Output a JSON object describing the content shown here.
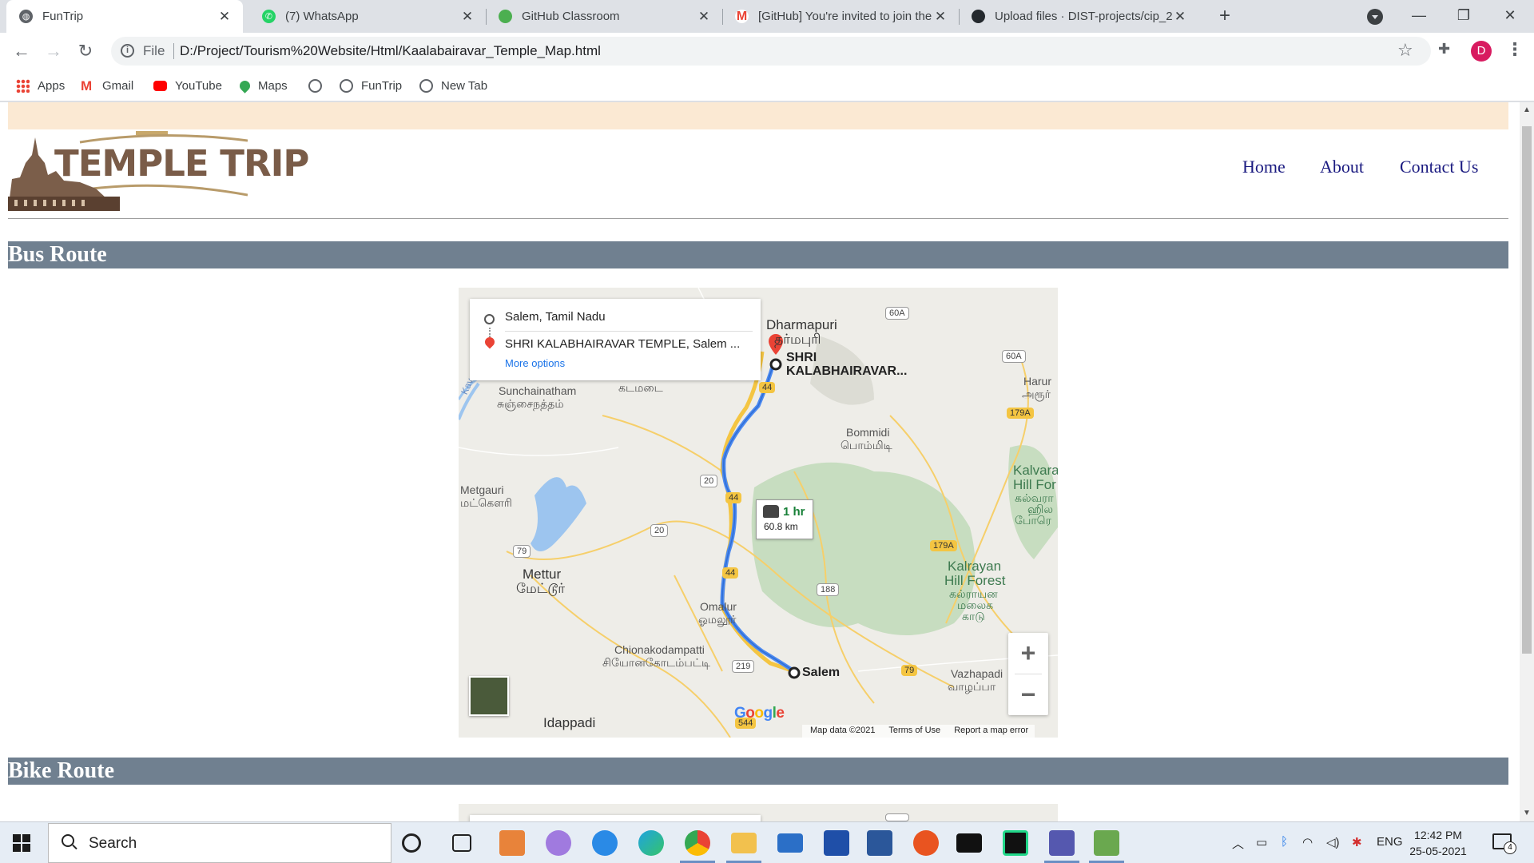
{
  "browser": {
    "tabs": [
      {
        "title": "FunTrip",
        "active": true
      },
      {
        "title": "(7) WhatsApp"
      },
      {
        "title": "GitHub Classroom"
      },
      {
        "title": "[GitHub] You're invited to join the"
      },
      {
        "title": "Upload files · DIST-projects/cip_2"
      }
    ],
    "url_scheme": "File",
    "url": "D:/Project/Tourism%20Website/Html/Kaalabairavar_Temple_Map.html",
    "profile_initial": "D",
    "bookmarks": [
      {
        "label": "Apps",
        "icon": "apps-grid-icon"
      },
      {
        "label": "Gmail",
        "icon": "gmail-icon"
      },
      {
        "label": "YouTube",
        "icon": "youtube-icon"
      },
      {
        "label": "Maps",
        "icon": "maps-pin-icon"
      },
      {
        "label": "",
        "icon": "globe-icon"
      },
      {
        "label": "FunTrip",
        "icon": "globe-icon"
      },
      {
        "label": "New Tab",
        "icon": "globe-icon"
      }
    ]
  },
  "site": {
    "logo_text": "TEMPLE TRIP",
    "nav": {
      "home": "Home",
      "about": "About",
      "contact": "Contact Us"
    }
  },
  "sections": {
    "bus": "Bus Route",
    "bike": "Bike Route"
  },
  "map": {
    "from": "Salem, Tamil Nadu",
    "to": "SHRI KALABHAIRAVAR TEMPLE, Salem ...",
    "more_options": "More options",
    "duration": "1 hr",
    "distance": "60.8 km",
    "google": "Google",
    "attribution": {
      "data": "Map data ©2021",
      "terms": "Terms of Use",
      "report": "Report a map error"
    },
    "labels": {
      "dharmapuri": "Dharmapuri",
      "dharmapuri_ta": "தர்மபுரி",
      "temple_1": "SHRI",
      "temple_2": "KALABHAIRAVAR...",
      "sunchainatham": "Sunchainatham",
      "sunchainatham_ta": "சுஞ்சைநத்தம்",
      "kadamadai_ta": "கடமடை",
      "harur": "Harur",
      "harur_ta": "அரூர்",
      "bommidi": "Bommidi",
      "bommidi_ta": "பொம்மிடி",
      "metgauri": "Metgauri",
      "metgauri_ta": "மட்கௌரி",
      "kalvarayan_1": "Kalvara",
      "kalvarayan_2": "Hill For",
      "kalvarayan_3": "கல்வரா",
      "kalvarayan_4": "ஹில",
      "kalvarayan_5": "போரெ",
      "mettur": "Mettur",
      "mettur_ta": "மேட்டூர்",
      "kalrayan_1": "Kalrayan",
      "kalrayan_2": "Hill Forest",
      "kalrayan_3": "கல்ராயன",
      "kalrayan_4": "மலைக",
      "kalrayan_5": "காடு",
      "omalur": "Omalur",
      "omalur_ta": "ஓமலூர்",
      "chionakodampatti": "Chionakodampatti",
      "chionakodampatti_ta": "சியோனகோடம்பட்டி",
      "salem": "Salem",
      "vazhapadi": "Vazhapadi",
      "vazhapadi_ta": "வாழப்பா",
      "idappadi": "Idappadi",
      "kaveri": "Kaveri R"
    },
    "shields": {
      "s60a_1": "60A",
      "s60a_2": "60A",
      "s179a_1": "179A",
      "s179a_2": "179A",
      "s44_1": "44",
      "s44_2": "44",
      "s44_3": "44",
      "s20_1": "20",
      "s20_2": "20",
      "s79_1": "79",
      "s79_2": "79",
      "s188": "188",
      "s219": "219",
      "s544": "544"
    }
  },
  "taskbar": {
    "search_placeholder": "Search",
    "lang": "ENG",
    "time": "12:42 PM",
    "date": "25-05-2021",
    "notifications": "4"
  }
}
